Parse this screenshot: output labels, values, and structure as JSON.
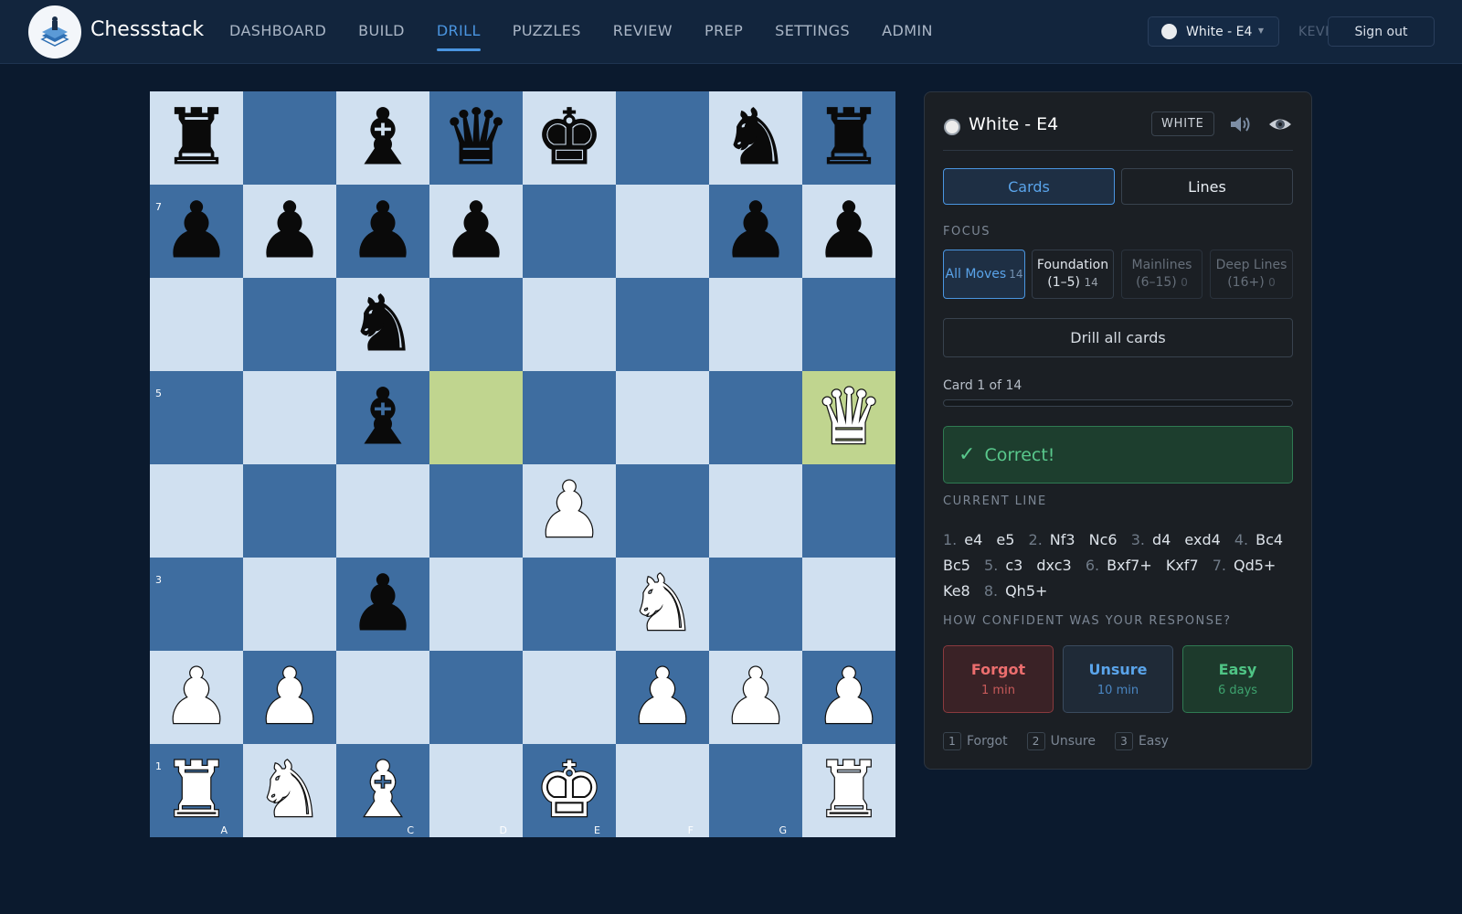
{
  "nav": {
    "brand": "Chessstack",
    "links": [
      "DASHBOARD",
      "BUILD",
      "DRILL",
      "PUZZLES",
      "REVIEW",
      "PREP",
      "SETTINGS",
      "ADMIN"
    ],
    "active": "DRILL",
    "repertoire_select": "White - E4",
    "user": "KEVIN",
    "signout": "Sign out"
  },
  "board": {
    "rank_labels": [
      "7",
      "5",
      "3",
      "1"
    ],
    "file_labels": [
      "A",
      "C",
      "D",
      "E",
      "F",
      "G"
    ],
    "highlight_squares": [
      "d5",
      "h5"
    ],
    "pieces": {
      "a8": "bR",
      "c8": "bB",
      "d8": "bQ",
      "e8": "bK",
      "g8": "bN",
      "h8": "bR",
      "a7": "bP",
      "b7": "bP",
      "c7": "bP",
      "d7": "bP",
      "g7": "bP",
      "h7": "bP",
      "c6": "bN",
      "c5": "bB",
      "h5": "wQ",
      "e4": "wP",
      "c3": "bP",
      "f3": "wN",
      "a2": "wP",
      "b2": "wP",
      "f2": "wP",
      "g2": "wP",
      "h2": "wP",
      "a1": "wR",
      "b1": "wN",
      "c1": "wB",
      "e1": "wK",
      "h1": "wR"
    }
  },
  "panel": {
    "title": "White - E4",
    "color_badge": "WHITE",
    "mode_cards": "Cards",
    "mode_lines": "Lines",
    "focus_label": "FOCUS",
    "focus": [
      {
        "label": "All Moves",
        "count": "14"
      },
      {
        "label": "Foundation",
        "label2": "(1–5)",
        "count": "14"
      },
      {
        "label": "Mainlines",
        "label2": "(6–15)",
        "count": "0"
      },
      {
        "label": "Deep Lines",
        "label2": "(16+)",
        "count": "0"
      }
    ],
    "drill_all": "Drill all cards",
    "progress_label": "Card 1 of 14",
    "progress_fraction": 0.0,
    "feedback": "Correct!",
    "feedback_icon": "✓",
    "current_line_label": "CURRENT LINE",
    "current_line": [
      {
        "n": "1.",
        "w": "e4",
        "b": "e5"
      },
      {
        "n": "2.",
        "w": "Nf3",
        "b": "Nc6"
      },
      {
        "n": "3.",
        "w": "d4",
        "b": "exd4"
      },
      {
        "n": "4.",
        "w": "Bc4",
        "b": "Bc5"
      },
      {
        "n": "5.",
        "w": "c3",
        "b": "dxc3"
      },
      {
        "n": "6.",
        "w": "Bxf7+",
        "b": "Kxf7"
      },
      {
        "n": "7.",
        "w": "Qd5+",
        "b": "Ke8"
      },
      {
        "n": "8.",
        "w": "Qh5+",
        "b": ""
      }
    ],
    "confidence_label": "HOW CONFIDENT WAS YOUR RESPONSE?",
    "confidence": {
      "forgot": {
        "label": "Forgot",
        "sub": "1 min"
      },
      "unsure": {
        "label": "Unsure",
        "sub": "10 min"
      },
      "easy": {
        "label": "Easy",
        "sub": "6 days"
      }
    },
    "shortcuts": [
      {
        "key": "1",
        "label": "Forgot"
      },
      {
        "key": "2",
        "label": "Unsure"
      },
      {
        "key": "3",
        "label": "Easy"
      }
    ]
  },
  "colors": {
    "accent": "#4a95e0",
    "light_square": "#d0e0f0",
    "dark_square": "#3e6da0",
    "highlight": "#c0d58f",
    "success": "#59c88c",
    "danger": "#ec6e6e"
  }
}
